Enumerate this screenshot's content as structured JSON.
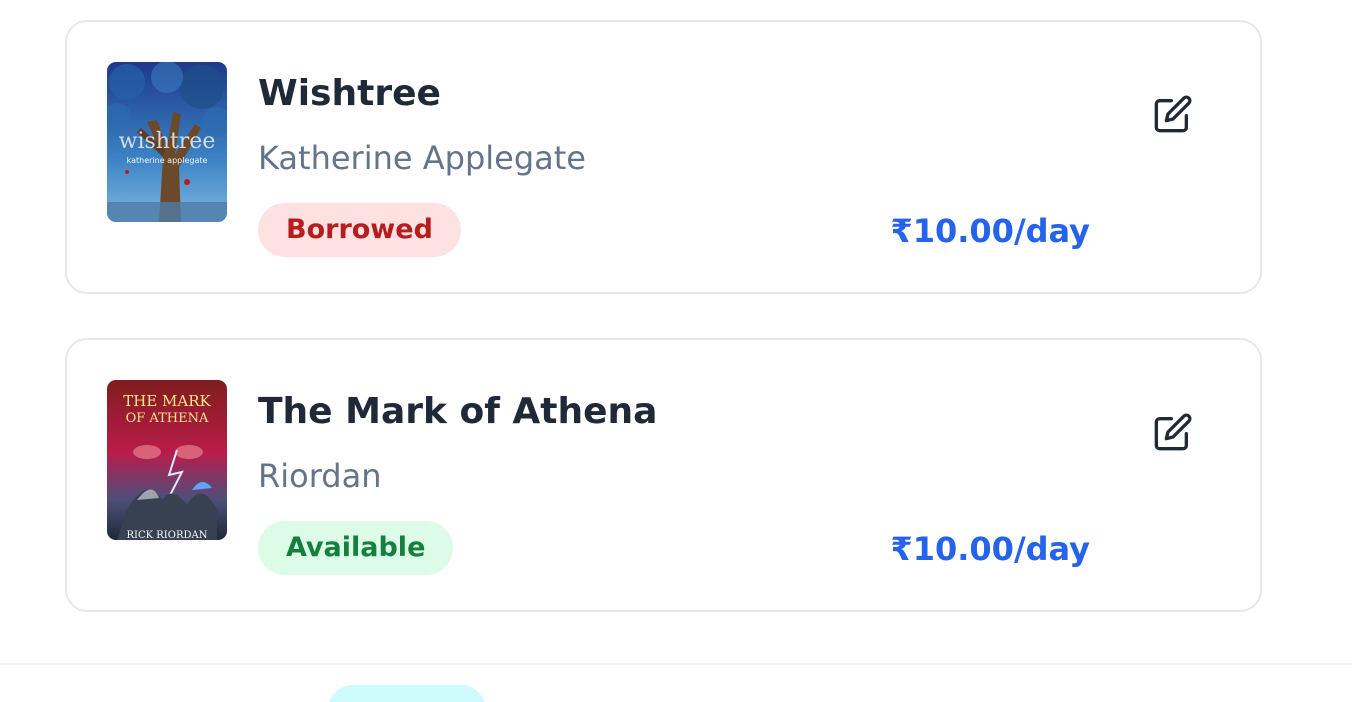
{
  "books": [
    {
      "title": "Wishtree",
      "author": "Katherine Applegate",
      "status": "Borrowed",
      "price": "₹10.00/day",
      "cover_text": "wishtree",
      "cover_subtext": "katherine applegate"
    },
    {
      "title": "The Mark of Athena",
      "author": "Riordan",
      "status": "Available",
      "price": "₹10.00/day",
      "cover_text_line1": "THE MARK",
      "cover_text_line2": "OF ATHENA",
      "cover_subtext": "RICK RIORDAN"
    }
  ],
  "icons": {
    "edit": "edit-icon"
  },
  "colors": {
    "borrowed_bg": "#fee2e2",
    "borrowed_text": "#b91c1c",
    "available_bg": "#dcfce7",
    "available_text": "#15803d",
    "price": "#2563eb"
  }
}
